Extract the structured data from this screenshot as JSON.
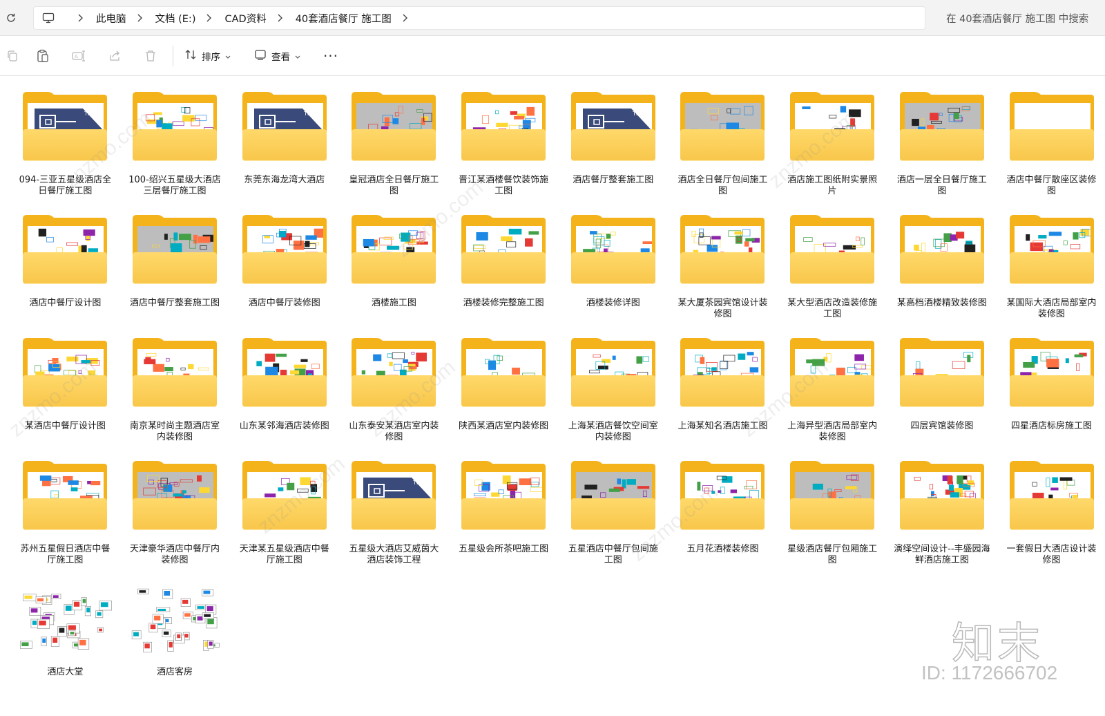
{
  "address_bar": {
    "refresh_icon": "refresh-icon",
    "computer_icon": "computer-icon",
    "breadcrumbs": [
      "此电脑",
      "文档 (E:)",
      "CAD资料",
      "40套酒店餐厅 施工图"
    ],
    "search_placeholder": "在 40套酒店餐厅 施工图 中搜索"
  },
  "toolbar": {
    "icons": [
      "copy-icon",
      "paste-icon",
      "rename-icon",
      "share-icon",
      "delete-icon"
    ],
    "sort_label": "排序",
    "view_label": "查看",
    "more_label": "···"
  },
  "items": [
    {
      "name": "094-三亚五星级酒店全日餐厅施工图",
      "kind": "folder",
      "preview": "cad-logo"
    },
    {
      "name": "100-绍兴五星级大酒店三层餐厅施工图",
      "kind": "folder",
      "preview": "drawing"
    },
    {
      "name": "东莞东海龙湾大酒店",
      "kind": "folder",
      "preview": "cad-logo"
    },
    {
      "name": "皇冠酒店全日餐厅施工图",
      "kind": "folder",
      "preview": "grey-drawing"
    },
    {
      "name": "晋江某酒楼餐饮装饰施工图",
      "kind": "folder",
      "preview": "drawing"
    },
    {
      "name": "酒店餐厅整套施工图",
      "kind": "folder",
      "preview": "cad-logo"
    },
    {
      "name": "酒店全日餐厅包间施工图",
      "kind": "folder",
      "preview": "grey-drawing"
    },
    {
      "name": "酒店施工图纸附实景照片",
      "kind": "folder",
      "preview": "drawing"
    },
    {
      "name": "酒店一层全日餐厅施工图",
      "kind": "folder",
      "preview": "grey-drawing"
    },
    {
      "name": "酒店中餐厅散座区装修图",
      "kind": "folder",
      "preview": "blank"
    },
    {
      "name": "酒店中餐厅设计图",
      "kind": "folder",
      "preview": "drawing"
    },
    {
      "name": "酒店中餐厅整套施工图",
      "kind": "folder",
      "preview": "grey-drawing"
    },
    {
      "name": "酒店中餐厅装修图",
      "kind": "folder",
      "preview": "drawing"
    },
    {
      "name": "酒楼施工图",
      "kind": "folder",
      "preview": "drawing"
    },
    {
      "name": "酒楼装修完整施工图",
      "kind": "folder",
      "preview": "drawing"
    },
    {
      "name": "酒楼装修详图",
      "kind": "folder",
      "preview": "drawing"
    },
    {
      "name": "某大厦茶园宾馆设计装修图",
      "kind": "folder",
      "preview": "drawing"
    },
    {
      "name": "某大型酒店改造装修施工图",
      "kind": "folder",
      "preview": "drawing"
    },
    {
      "name": "某高档酒楼精致装修图",
      "kind": "folder",
      "preview": "drawing"
    },
    {
      "name": "某国际大酒店局部室内装修图",
      "kind": "folder",
      "preview": "drawing"
    },
    {
      "name": "某酒店中餐厅设计图",
      "kind": "folder",
      "preview": "drawing"
    },
    {
      "name": "南京某时尚主题酒店室内装修图",
      "kind": "folder",
      "preview": "drawing"
    },
    {
      "name": "山东某邻海酒店装修图",
      "kind": "folder",
      "preview": "drawing"
    },
    {
      "name": "山东泰安某酒店室内装修图",
      "kind": "folder",
      "preview": "drawing"
    },
    {
      "name": "陕西某酒店室内装修图",
      "kind": "folder",
      "preview": "drawing"
    },
    {
      "name": "上海某酒店餐饮空间室内装修图",
      "kind": "folder",
      "preview": "drawing"
    },
    {
      "name": "上海某知名酒店施工图",
      "kind": "folder",
      "preview": "drawing"
    },
    {
      "name": "上海异型酒店局部室内装修图",
      "kind": "folder",
      "preview": "drawing"
    },
    {
      "name": "四层宾馆装修图",
      "kind": "folder",
      "preview": "drawing"
    },
    {
      "name": "四星酒店标房施工图",
      "kind": "folder",
      "preview": "drawing"
    },
    {
      "name": "苏州五星假日酒店中餐厅施工图",
      "kind": "folder",
      "preview": "drawing"
    },
    {
      "name": "天津豪华酒店中餐厅内装修图",
      "kind": "folder",
      "preview": "grey-drawing"
    },
    {
      "name": "天津某五星级酒店中餐厅施工图",
      "kind": "folder",
      "preview": "drawing"
    },
    {
      "name": "五星级大酒店艾威茵大酒店装饰工程",
      "kind": "folder",
      "preview": "cad-logo"
    },
    {
      "name": "五星级会所茶吧施工图",
      "kind": "folder",
      "preview": "drawing"
    },
    {
      "name": "五星酒店中餐厅包间施工图",
      "kind": "folder",
      "preview": "grey-drawing"
    },
    {
      "name": "五月花酒楼装修图",
      "kind": "folder",
      "preview": "drawing"
    },
    {
      "name": "星级酒店餐厅包厢施工图",
      "kind": "folder",
      "preview": "grey-drawing"
    },
    {
      "name": "演绎空间设计--丰盛园海鲜酒店施工图",
      "kind": "folder",
      "preview": "drawing"
    },
    {
      "name": "一套假日大酒店设计装修图",
      "kind": "folder",
      "preview": "drawing"
    },
    {
      "name": "酒店大堂",
      "kind": "file",
      "preview": "sheets"
    },
    {
      "name": "酒店客房",
      "kind": "file",
      "preview": "sheets"
    }
  ],
  "watermark": {
    "brand": "知末",
    "id_text": "ID: 1172666702"
  }
}
